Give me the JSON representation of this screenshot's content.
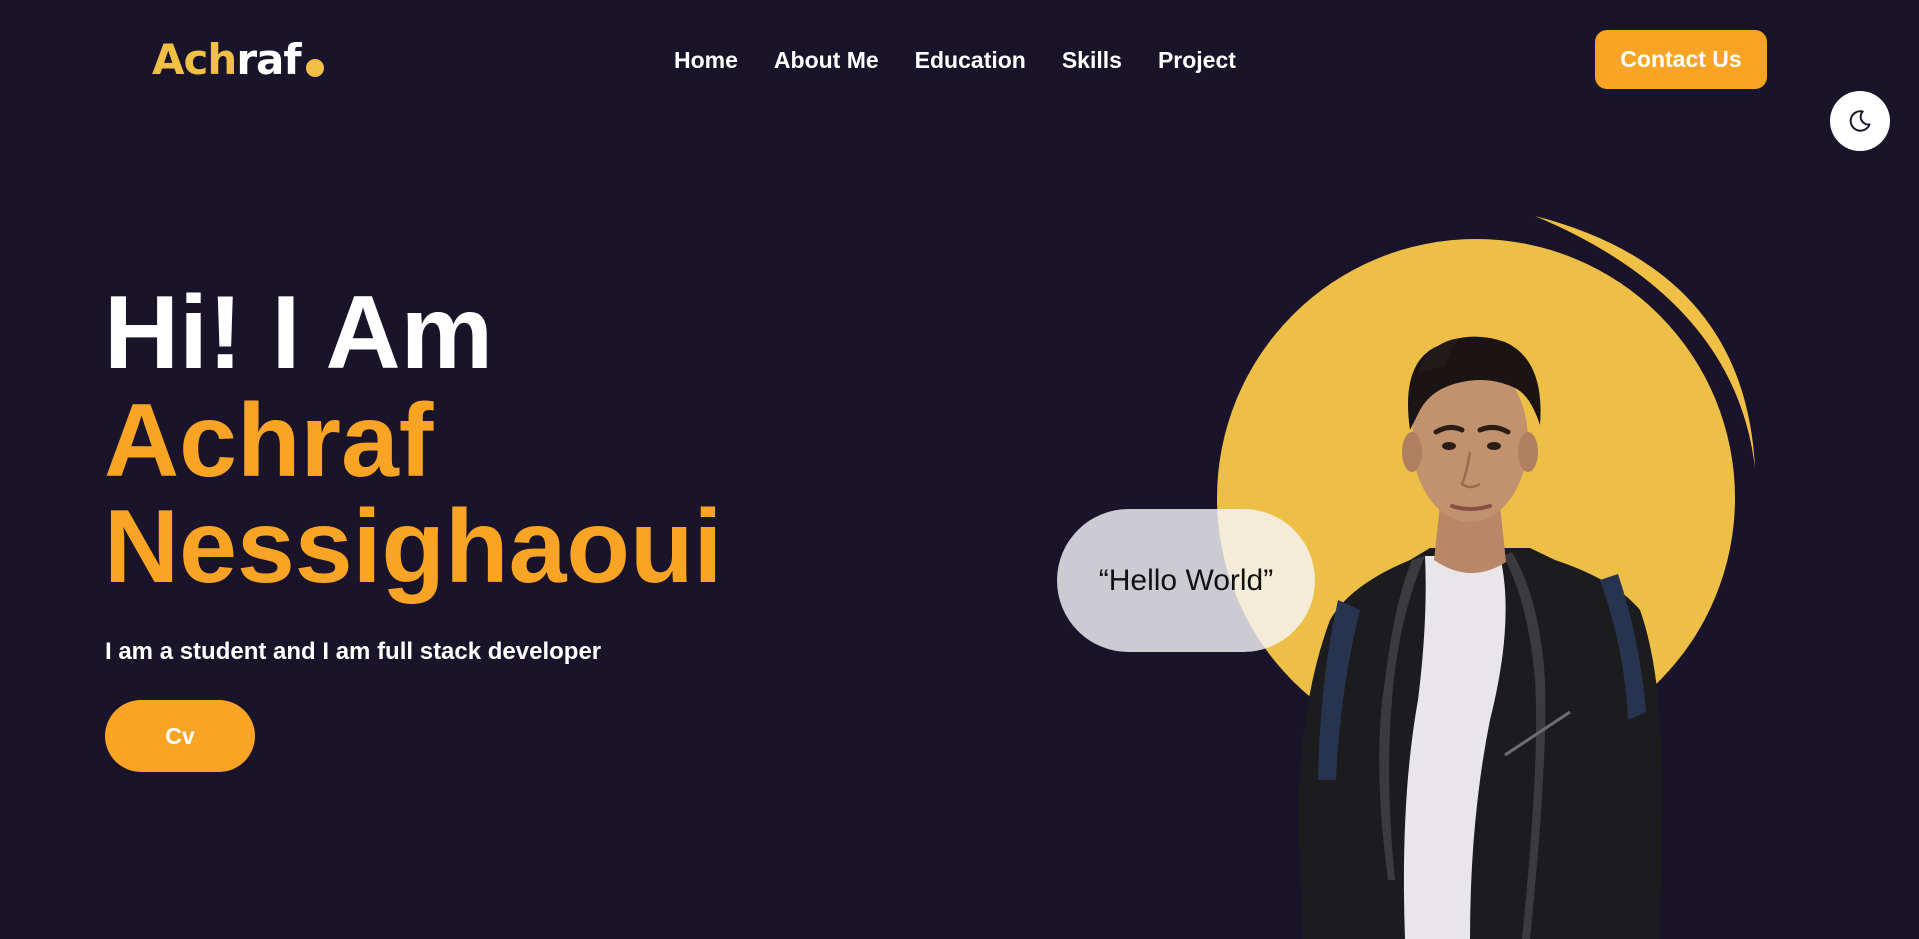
{
  "logo": {
    "part_accent": "Ach",
    "part_main": "raf"
  },
  "nav": {
    "items": [
      "Home",
      "About Me",
      "Education",
      "Skills",
      "Project"
    ]
  },
  "header": {
    "contact_label": "Contact Us",
    "theme_icon": "moon-icon"
  },
  "hero": {
    "greeting": "Hi! I Am",
    "name_line1": "Achraf",
    "name_line2": "Nessighaoui",
    "description": "I am a student and I am full stack developer",
    "cv_label": "Cv",
    "bubble_text": "“Hello World”"
  },
  "colors": {
    "background": "#1a142b",
    "accent_orange": "#f9a424",
    "accent_yellow": "#f0bf45",
    "text": "#ffffff"
  }
}
